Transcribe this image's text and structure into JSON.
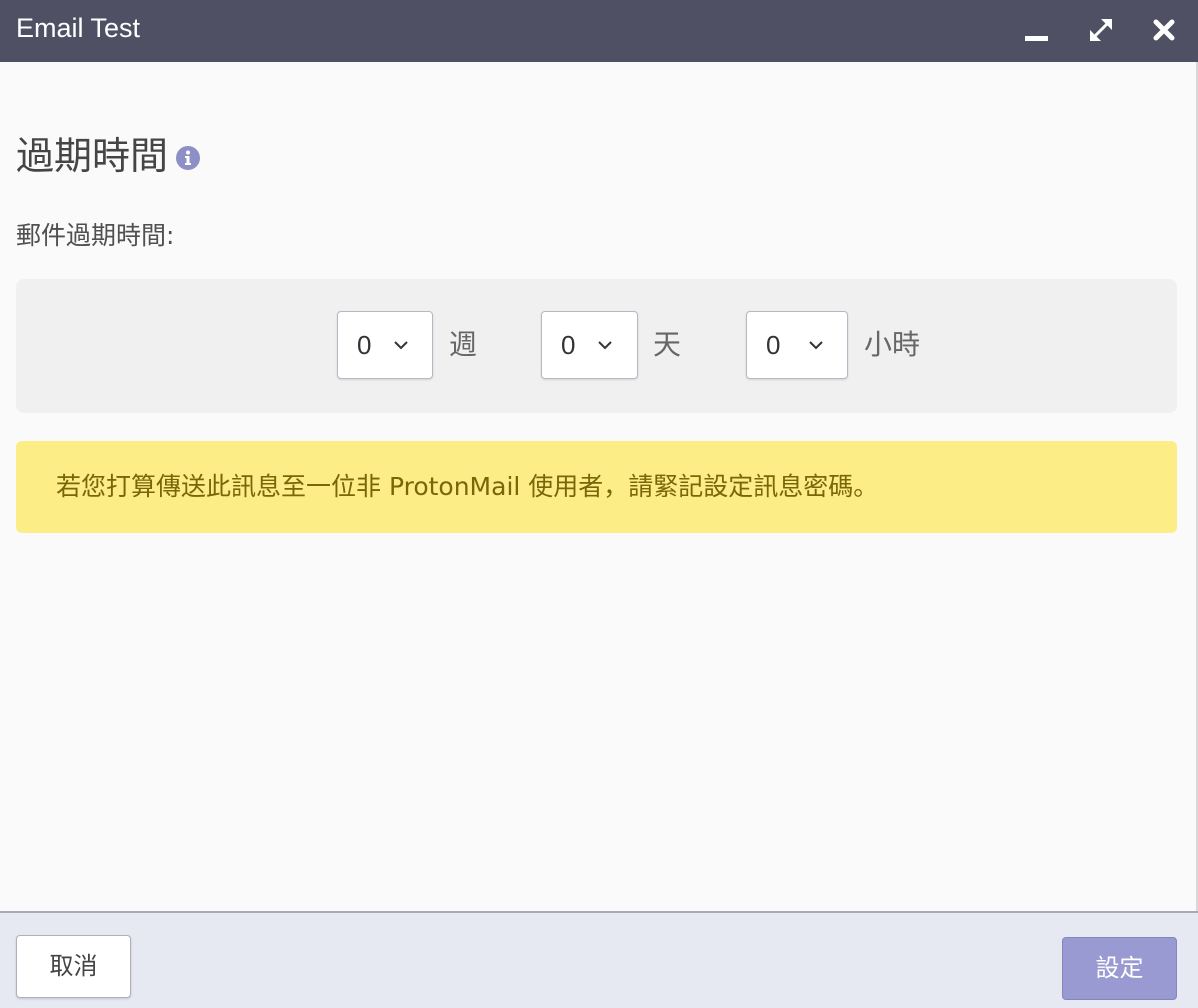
{
  "window": {
    "title": "Email Test",
    "controls": [
      "minimize-icon",
      "maximize-icon",
      "close-icon"
    ]
  },
  "section": {
    "heading": "過期時間",
    "info_icon": "info-icon",
    "label": "郵件過期時間:"
  },
  "expiration": {
    "weeks": {
      "value": "0",
      "unit": "週"
    },
    "days": {
      "value": "0",
      "unit": "天"
    },
    "hours": {
      "value": "0",
      "unit": "小時"
    }
  },
  "notice": {
    "text": "若您打算傳送此訊息至一位非 ProtonMail 使用者，請緊記設定訊息密碼。"
  },
  "footer": {
    "cancel_label": "取消",
    "confirm_label": "設定"
  },
  "colors": {
    "titlebar": "#505064",
    "accent": "#9a9ad2",
    "notice_bg": "#fced87",
    "notice_text": "#7a6508"
  }
}
